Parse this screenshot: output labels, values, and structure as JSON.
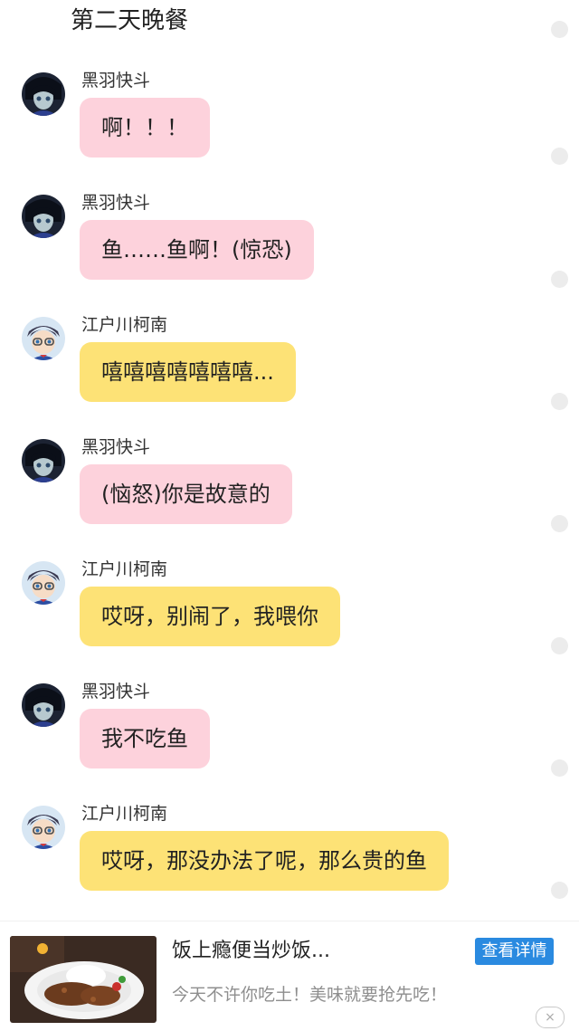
{
  "section_title": "第二天晚餐",
  "messages": [
    {
      "sender": "黑羽快斗",
      "text": "啊！！！",
      "color": "pink",
      "avatar": "kaito-avatar"
    },
    {
      "sender": "黑羽快斗",
      "text": "鱼……鱼啊！(惊恐)",
      "color": "pink",
      "avatar": "kaito-avatar"
    },
    {
      "sender": "江户川柯南",
      "text": "嘻嘻嘻嘻嘻嘻嘻...",
      "color": "yellow",
      "avatar": "conan-avatar"
    },
    {
      "sender": "黑羽快斗",
      "text": "(恼怒)你是故意的",
      "color": "pink",
      "avatar": "kaito-avatar"
    },
    {
      "sender": "江户川柯南",
      "text": "哎呀，别闹了，我喂你",
      "color": "yellow",
      "avatar": "conan-avatar"
    },
    {
      "sender": "黑羽快斗",
      "text": "我不吃鱼",
      "color": "pink",
      "avatar": "kaito-avatar"
    },
    {
      "sender": "江户川柯南",
      "text": "哎呀，那没办法了呢，那么贵的鱼",
      "color": "yellow",
      "avatar": "conan-avatar"
    }
  ],
  "ad": {
    "title": "饭上瘾便当炒饭...",
    "description": "今天不许你吃土！美味就要抢先吃！",
    "button_label": "查看详情",
    "close_icon": "×"
  },
  "colors": {
    "pink_bubble": "#fdd2dc",
    "yellow_bubble": "#fde276",
    "ad_button": "#2a8ae0"
  }
}
